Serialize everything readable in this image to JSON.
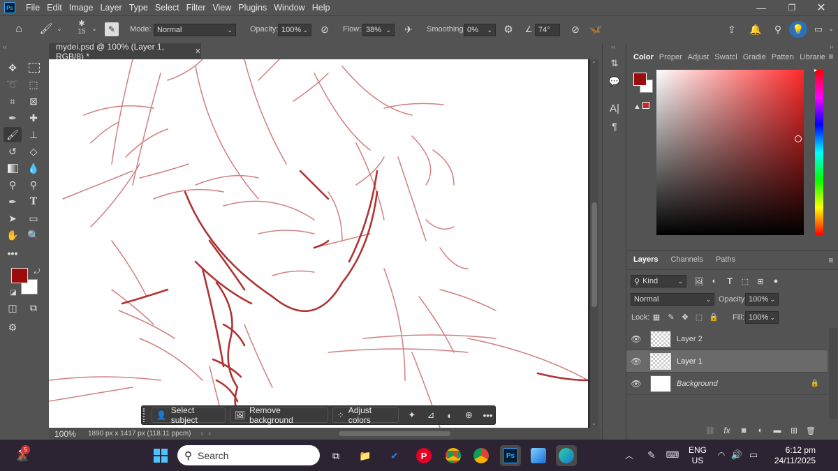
{
  "app": {
    "logo": "Ps",
    "brand_color": "#31a8ff"
  },
  "menu": [
    "File",
    "Edit",
    "Image",
    "Layer",
    "Type",
    "Select",
    "Filter",
    "View",
    "Plugins",
    "Window",
    "Help"
  ],
  "options": {
    "brush_size": "15",
    "mode_label": "Mode:",
    "mode_value": "Normal",
    "opacity_label": "Opacity:",
    "opacity_value": "100%",
    "flow_label": "Flow:",
    "flow_value": "38%",
    "smoothing_label": "Smoothing:",
    "smoothing_value": "0%",
    "angle_value": "74°"
  },
  "document": {
    "tab_title": "mydei.psd @ 100% (Layer 1, RGB/8) *",
    "zoom": "100%",
    "status_info": "1890 px x 1417 px (118.11 ppcm)"
  },
  "context_bar": {
    "select_subject": "Select subject",
    "remove_background": "Remove background",
    "adjust_colors": "Adjust colors"
  },
  "color_panel": {
    "tabs": [
      "Color",
      "Proper",
      "Adjust",
      "Swatcl",
      "Gradie",
      "Patterı",
      "Librarie"
    ],
    "foreground": "#9b0d0d",
    "background": "#ffffff",
    "hue_color": "#ff2a2a"
  },
  "layers_panel": {
    "tabs": [
      "Layers",
      "Channels",
      "Paths"
    ],
    "filter_label": "Kind",
    "blend_mode": "Normal",
    "opacity_label": "Opacity:",
    "opacity_value": "100%",
    "lock_label": "Lock:",
    "fill_label": "Fill:",
    "fill_value": "100%",
    "layers": [
      {
        "name": "Layer 2"
      },
      {
        "name": "Layer 1"
      },
      {
        "name": "Background"
      }
    ]
  },
  "taskbar": {
    "search_placeholder": "Search",
    "weather_badge": "5",
    "language": "ENG",
    "region": "US",
    "time": "6:12 pm",
    "date": "24/11/2025"
  }
}
